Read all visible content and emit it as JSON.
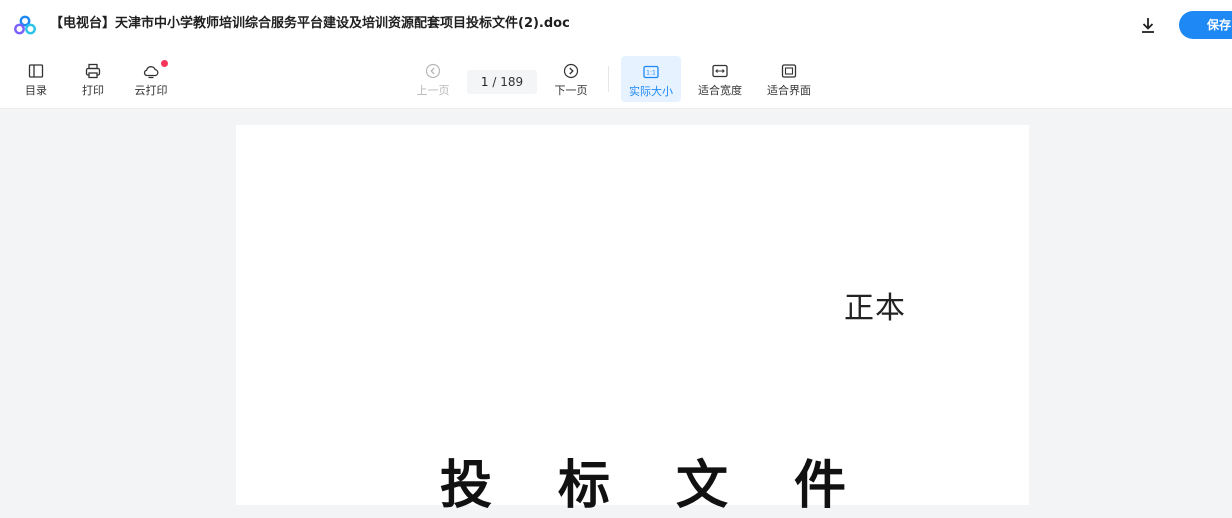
{
  "titlebar": {
    "title": "【电视台】天津市中小学教师培训综合服务平台建设及培训资源配套项目投标文件(2).doc",
    "save_label": "保存"
  },
  "toolbar": {
    "toc_label": "目录",
    "print_label": "打印",
    "cloud_print_label": "云打印",
    "prev_label": "上一页",
    "current_page": "1",
    "total_pages": "/ 189",
    "next_label": "下一页",
    "actual_size_label": "实际大小",
    "fit_width_label": "适合宽度",
    "fit_screen_label": "适合界面"
  },
  "document": {
    "copy_mark": "正本",
    "heading_chars": [
      "投",
      "标",
      "文",
      "件"
    ]
  },
  "colors": {
    "accent": "#1e88f5",
    "active_bg": "#e6f2ff",
    "badge": "#f5365c"
  }
}
